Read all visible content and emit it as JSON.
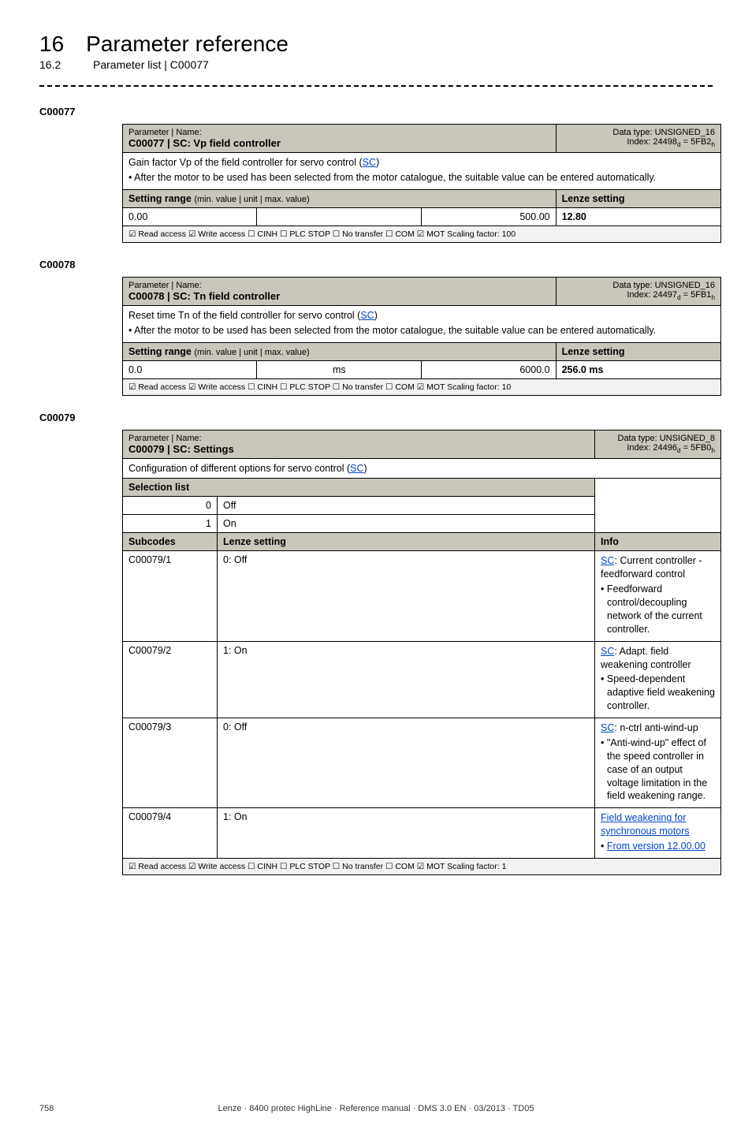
{
  "header": {
    "chapter_num": "16",
    "chapter_title": "Parameter reference",
    "section_num": "16.2",
    "section_title": "Parameter list | C00077"
  },
  "params": [
    {
      "id": "C00077",
      "name_label": "Parameter | Name:",
      "name_main": "C00077 | SC: Vp field controller",
      "dtype_line1": "Data type: UNSIGNED_16",
      "dtype_line2_pre": "Index: 24498",
      "dtype_line2_sub1": "d",
      "dtype_line2_mid": " = 5FB2",
      "dtype_line2_sub2": "h",
      "desc_main_pre": "Gain factor Vp of the field controller for servo control (",
      "desc_main_link": "SC",
      "desc_main_post": ")",
      "desc_bullet": "After the motor to be used has been selected from the motor catalogue, the suitable value can be entered automatically.",
      "range_hdr": "Setting range (min. value | unit | max. value)",
      "lenze_hdr": "Lenze setting",
      "range_min": "0.00",
      "range_unit": "",
      "range_max": "500.00",
      "lenze_val": "12.80",
      "flags": "☑ Read access   ☑ Write access   ☐ CINH   ☐ PLC STOP   ☐ No transfer   ☐ COM   ☑ MOT    Scaling factor: 100"
    },
    {
      "id": "C00078",
      "name_label": "Parameter | Name:",
      "name_main": "C00078 | SC: Tn field controller",
      "dtype_line1": "Data type: UNSIGNED_16",
      "dtype_line2_pre": "Index: 24497",
      "dtype_line2_sub1": "d",
      "dtype_line2_mid": " = 5FB1",
      "dtype_line2_sub2": "h",
      "desc_main_pre": "Reset time Tn of the field controller for servo control (",
      "desc_main_link": "SC",
      "desc_main_post": ")",
      "desc_bullet": "After the motor to be used has been selected from the motor catalogue, the suitable value can be entered automatically.",
      "range_hdr": "Setting range (min. value | unit | max. value)",
      "lenze_hdr": "Lenze setting",
      "range_min": "0.0",
      "range_unit": "ms",
      "range_max": "6000.0",
      "lenze_val": "256.0 ms",
      "flags": "☑ Read access   ☑ Write access   ☐ CINH   ☐ PLC STOP   ☐ No transfer   ☐ COM   ☑ MOT    Scaling factor: 10"
    }
  ],
  "param79": {
    "id": "C00079",
    "name_label": "Parameter | Name:",
    "name_main": "C00079 | SC: Settings",
    "dtype_line1": "Data type: UNSIGNED_8",
    "dtype_line2_pre": "Index: 24496",
    "dtype_line2_sub1": "d",
    "dtype_line2_mid": " = 5FB0",
    "dtype_line2_sub2": "h",
    "desc_pre": "Configuration of different options for servo control (",
    "desc_link": "SC",
    "desc_post": ")",
    "sel_hdr": "Selection list",
    "sel0_idx": "0",
    "sel0_val": "Off",
    "sel1_idx": "1",
    "sel1_val": "On",
    "sub_hdr": "Subcodes",
    "lenze_hdr": "Lenze setting",
    "info_hdr": "Info",
    "rows": [
      {
        "sub": "C00079/1",
        "lenze": "0: Off",
        "info_link": "SC",
        "info_post": ": Current controller - feedforward control",
        "info_bullet": "Feedforward control/decoupling network of the current controller."
      },
      {
        "sub": "C00079/2",
        "lenze": "1: On",
        "info_link": "SC",
        "info_post": ": Adapt. field weakening controller",
        "info_bullet": "Speed-dependent adaptive field weakening controller."
      },
      {
        "sub": "C00079/3",
        "lenze": "0: Off",
        "info_link": "SC",
        "info_post": ": n-ctrl anti-wind-up",
        "info_bullet": "\"Anti-wind-up\" effect of the speed controller in case of an output voltage limitation in the field weakening range."
      },
      {
        "sub": "C00079/4",
        "lenze": "1: On",
        "info_link_full": "Field weakening for synchronous motors",
        "info_bullet_link": "From version 12.00.00"
      }
    ],
    "flags": "☑ Read access   ☑ Write access   ☐ CINH   ☐ PLC STOP   ☐ No transfer   ☐ COM   ☑ MOT    Scaling factor: 1"
  },
  "footer": {
    "page": "758",
    "text": "Lenze · 8400 protec HighLine · Reference manual · DMS 3.0 EN · 03/2013 · TD05"
  }
}
